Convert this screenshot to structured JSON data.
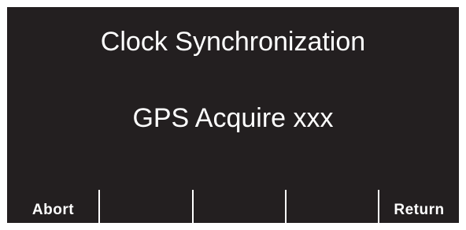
{
  "screen": {
    "title": "Clock Synchronization",
    "status": "GPS Acquire xxx"
  },
  "softkeys": [
    {
      "label": "Abort"
    },
    {
      "label": ""
    },
    {
      "label": ""
    },
    {
      "label": ""
    },
    {
      "label": "Return"
    }
  ],
  "colors": {
    "screen_background": "#231f20",
    "text": "#ffffff",
    "bezel": "#ffffff"
  }
}
